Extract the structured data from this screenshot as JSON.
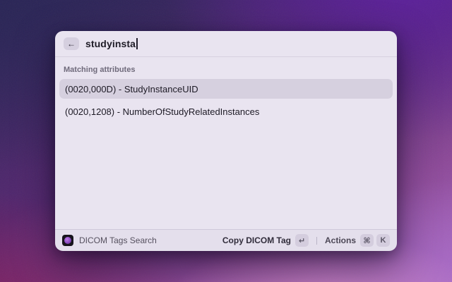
{
  "window": {
    "search": {
      "back_icon": "←",
      "value": "studyinsta"
    },
    "section_header": "Matching attributes",
    "results": [
      {
        "label": "(0020,000D) - StudyInstanceUID",
        "selected": true
      },
      {
        "label": "(0020,1208) - NumberOfStudyRelatedInstances",
        "selected": false
      }
    ],
    "footer": {
      "app_icon": "dicom-app-icon",
      "app_name": "DICOM Tags Search",
      "primary_action_label": "Copy DICOM Tag",
      "primary_action_key": "↵",
      "actions_label": "Actions",
      "actions_key_1": "⌘",
      "actions_key_2": "K"
    }
  },
  "colors": {
    "window_background": "#e9e4f0",
    "selected_row_background": "#d6d0df",
    "background_top_left": "#2d2558",
    "background_top_right": "#5c1e9e",
    "background_bottom_left": "#821450",
    "background_bottom_right": "#a868c2",
    "app_icon_background": "#17141c",
    "app_icon_blob": "#8a4cc0"
  }
}
